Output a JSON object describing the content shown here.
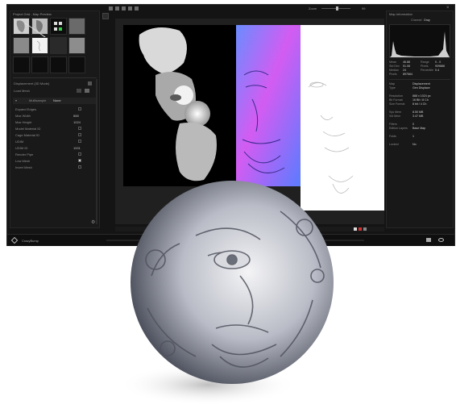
{
  "left_panel": {
    "title": "Project Grid - Map Preview",
    "mode_label": "Displacement (3D Mode)",
    "load_mesh": "Load Mesh",
    "section_title": "Multisample",
    "section_value": "None",
    "props": [
      {
        "label": "Expand Edges",
        "value": "",
        "type": "toggle"
      },
      {
        "label": "Max Width",
        "value": "888",
        "type": "value"
      },
      {
        "label": "Max Height",
        "value": "1024",
        "type": "value"
      },
      {
        "label": "Model Material ID",
        "value": "",
        "type": "toggle"
      },
      {
        "label": "Cage Material ID",
        "value": "",
        "type": "toggle"
      },
      {
        "label": "UDIM",
        "value": "",
        "type": "toggle"
      },
      {
        "label": "UDIM ID",
        "value": "1001",
        "type": "value"
      },
      {
        "label": "Render Pipe",
        "value": "",
        "type": "check"
      },
      {
        "label": "Low Mesh",
        "value": "",
        "type": "check"
      },
      {
        "label": "Invert Mesh",
        "value": "",
        "type": "check"
      }
    ]
  },
  "toolbar": {
    "zoom_label": "Zoom",
    "zoom_value": "99"
  },
  "right_panel": {
    "title": "Map Information",
    "channel_label": "Channel",
    "channel_value": "Gray",
    "stats": [
      {
        "k1": "Mean",
        "v1": "46.88",
        "k2": "Range",
        "v2": "0 - 0"
      },
      {
        "k1": "Std Dev",
        "v1": "51.08",
        "k2": "Pixels",
        "v2": "909888"
      },
      {
        "k1": "Median",
        "v1": "24",
        "k2": "Percentile",
        "v2": "0.4"
      },
      {
        "k1": "Pixels",
        "v1": "897664",
        "k2": "",
        "v2": ""
      }
    ],
    "info": [
      {
        "k": "Map",
        "v": "Displacement"
      },
      {
        "k": "Type",
        "v": "Gen Displace"
      },
      {
        "k": "",
        "v": ""
      },
      {
        "k": "Resolution",
        "v": "888 x 1024 px"
      },
      {
        "k": "Bit Format",
        "v": "16 Bit / 8 Ch"
      },
      {
        "k": "Size Format",
        "v": "8 bit / 4 Ch"
      },
      {
        "k": "",
        "v": ""
      },
      {
        "k": "Sys Mem",
        "v": "8.50 MB"
      },
      {
        "k": "Vid Mem",
        "v": "3.47 MB"
      },
      {
        "k": "",
        "v": ""
      },
      {
        "k": "Filters",
        "v": "0"
      },
      {
        "k": "Edition Layers",
        "v": "Base Map"
      },
      {
        "k": "",
        "v": ""
      },
      {
        "k": "Folds",
        "v": "1"
      },
      {
        "k": "",
        "v": ""
      },
      {
        "k": "Locked",
        "v": "No"
      }
    ]
  },
  "footer": {
    "brand": "CrazyBump"
  },
  "colors": {
    "window_bg": "#141414",
    "normal_map_blue": "#7f7fff",
    "normal_map_magenta": "#d85cf0"
  }
}
